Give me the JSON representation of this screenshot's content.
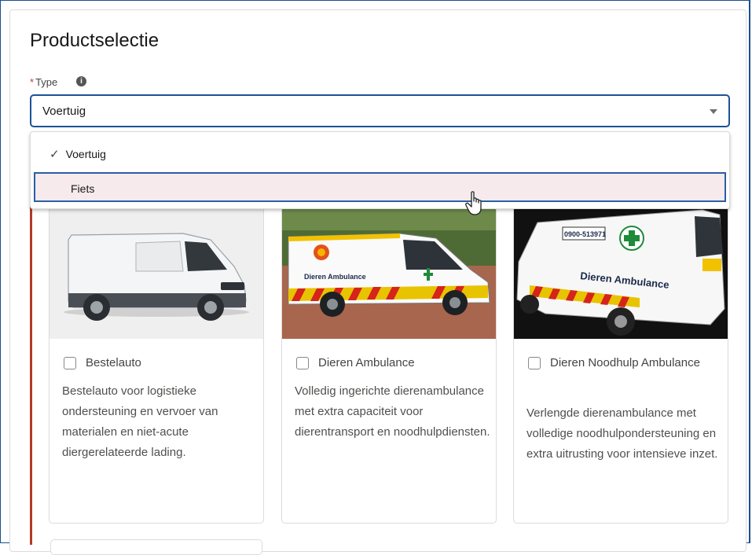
{
  "form": {
    "title": "Productselectie",
    "type_field": {
      "required_marker": "*",
      "label": "Type",
      "info_icon": "i",
      "selected_value": "Voertuig"
    },
    "dropdown": {
      "options": [
        {
          "label": "Voertuig",
          "selected": true
        },
        {
          "label": "Fiets",
          "selected": false
        }
      ]
    }
  },
  "products": [
    {
      "name": "Bestelauto",
      "description": "Bestelauto voor logistieke ondersteuning en vervoer van materialen en niet-acute diergerelateerde lading.",
      "checked": false,
      "image": "white-van"
    },
    {
      "name": "Dieren Ambulance",
      "description": "Volledig ingerichte dierenambulance met extra capaciteit voor dierentransport en noodhulpdiensten.",
      "checked": false,
      "image": "animal-ambulance-van"
    },
    {
      "name": "Dieren Noodhulp Ambulance",
      "description": "Verlengde dierenambulance met volledige noodhulpondersteuning en extra uitrusting voor intensieve inzet.",
      "checked": false,
      "image": "emergency-animal-ambulance-van"
    }
  ],
  "van_text": {
    "brand": "Dieren Ambulance",
    "phone": "0900-513971"
  },
  "colors": {
    "focus_border": "#1b5297",
    "required": "#c23934",
    "highlight_bg": "#f6eaec",
    "accent_line": "#b33a26"
  }
}
